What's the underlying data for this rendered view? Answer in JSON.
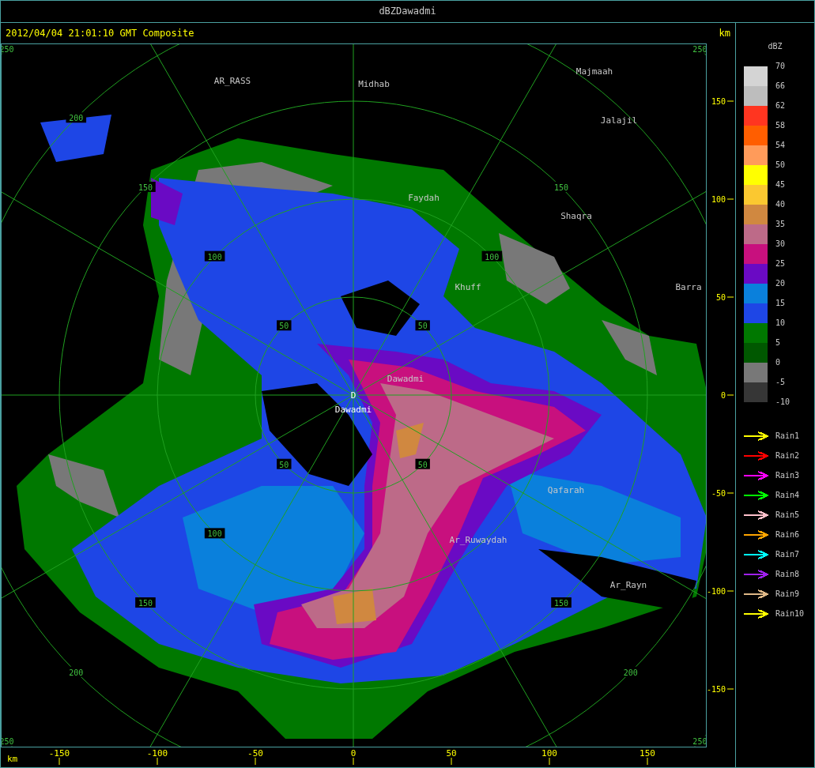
{
  "window": {
    "title": "dBZDawadmi"
  },
  "header": {
    "timestamp": "2012/04/04 21:01:10 GMT Composite",
    "unit": "km"
  },
  "map": {
    "site": {
      "marker": "D",
      "name": "Dawadmi"
    },
    "places": [
      {
        "name": "AR_RASS"
      },
      {
        "name": "Midhab"
      },
      {
        "name": "Majmaah"
      },
      {
        "name": "Jalajil"
      },
      {
        "name": "Faydah"
      },
      {
        "name": "Shaqra"
      },
      {
        "name": "Khuff"
      },
      {
        "name": "Barra"
      },
      {
        "name": "Dawadmi"
      },
      {
        "name": "Qafarah"
      },
      {
        "name": "Ar_Ruwaydah"
      },
      {
        "name": "Ar_Rayn"
      }
    ],
    "ring_labels": [
      "250",
      "200",
      "150",
      "100",
      "50",
      "50",
      "100",
      "150",
      "250",
      "50",
      "100",
      "150",
      "200",
      "250",
      "50",
      "150",
      "200",
      "250"
    ]
  },
  "y_axis": {
    "ticks": [
      "150",
      "100",
      "50",
      "0",
      "-50",
      "-100",
      "-150"
    ]
  },
  "x_axis": {
    "unit": "km",
    "ticks": [
      "-150",
      "-100",
      "-50",
      "0",
      "50",
      "100",
      "150"
    ]
  },
  "legend": {
    "title": "dBZ",
    "values": [
      "70",
      "66",
      "62",
      "58",
      "54",
      "50",
      "45",
      "40",
      "35",
      "30",
      "25",
      "20",
      "15",
      "10",
      "5",
      "0",
      "-5",
      "-10"
    ],
    "bands": [
      {
        "color": "#d4d4d4"
      },
      {
        "color": "#bdbdbd"
      },
      {
        "color": "#ff3520"
      },
      {
        "color": "#ff5e00"
      },
      {
        "color": "#ff9b5a"
      },
      {
        "color": "#ffff00"
      },
      {
        "color": "#fbc830"
      },
      {
        "color": "#d08840"
      },
      {
        "color": "#bd6a88"
      },
      {
        "color": "#c8107e"
      },
      {
        "color": "#6a0ac4"
      },
      {
        "color": "#0a80dc"
      },
      {
        "color": "#1e46e6"
      },
      {
        "color": "#007800"
      },
      {
        "color": "#005800"
      },
      {
        "color": "#787878"
      },
      {
        "color": "#363636"
      }
    ],
    "tracks": [
      {
        "label": "Rain1",
        "color": "#ffff00"
      },
      {
        "label": "Rain2",
        "color": "#ff0000"
      },
      {
        "label": "Rain3",
        "color": "#ff00ff"
      },
      {
        "label": "Rain4",
        "color": "#00ff00"
      },
      {
        "label": "Rain5",
        "color": "#ffc0cb"
      },
      {
        "label": "Rain6",
        "color": "#ffa500"
      },
      {
        "label": "Rain7",
        "color": "#00ffff"
      },
      {
        "label": "Rain8",
        "color": "#a020f0"
      },
      {
        "label": "Rain9",
        "color": "#deb887"
      },
      {
        "label": "Rain10",
        "color": "#ffff00"
      }
    ]
  }
}
